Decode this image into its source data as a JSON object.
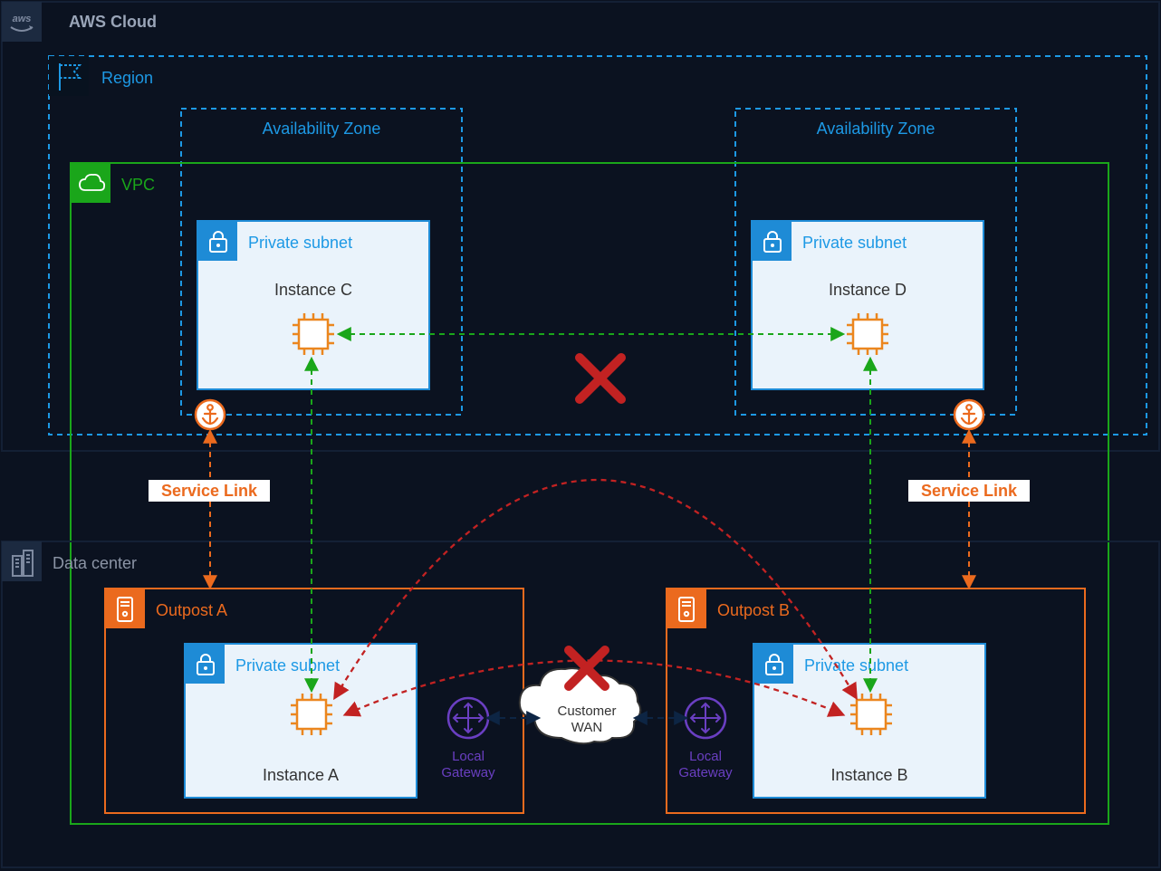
{
  "cloud": {
    "label": "AWS Cloud"
  },
  "region": {
    "label": "Region"
  },
  "vpc": {
    "label": "VPC"
  },
  "azs": [
    {
      "label": "Availability Zone",
      "subnet": {
        "label": "Private subnet",
        "instance": "Instance C"
      }
    },
    {
      "label": "Availability Zone",
      "subnet": {
        "label": "Private subnet",
        "instance": "Instance D"
      }
    }
  ],
  "datacenter": {
    "label": "Data center"
  },
  "outposts": [
    {
      "label": "Outpost A",
      "subnet": {
        "label": "Private subnet",
        "instance": "Instance A"
      },
      "gateway": "Local\nGateway"
    },
    {
      "label": "Outpost B",
      "subnet": {
        "label": "Private subnet",
        "instance": "Instance B"
      },
      "gateway": "Local\nGateway"
    }
  ],
  "service_links": [
    {
      "label": "Service Link"
    },
    {
      "label": "Service Link"
    }
  ],
  "wan": {
    "label": "Customer\nWAN"
  }
}
